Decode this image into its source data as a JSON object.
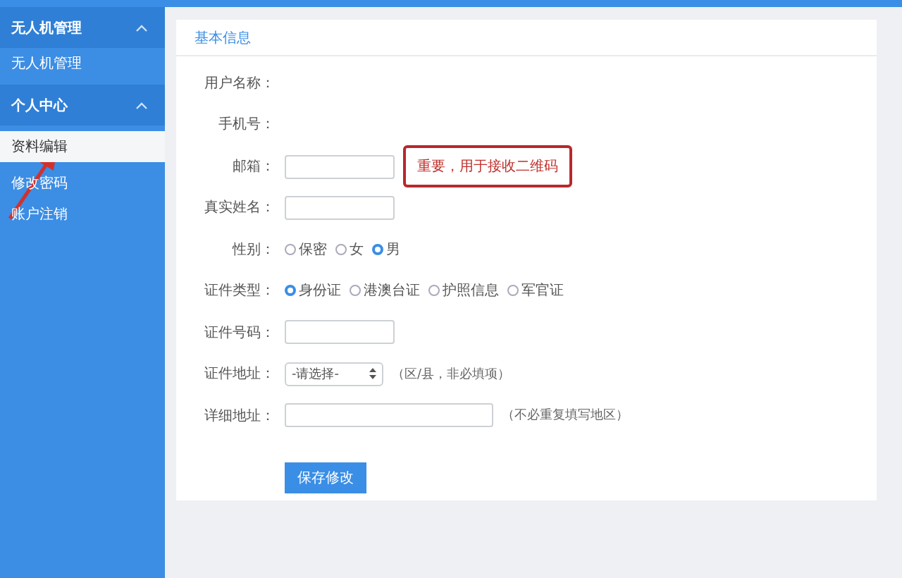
{
  "sidebar": {
    "groups": [
      {
        "title": "无人机管理",
        "expanded": true,
        "items": [
          {
            "label": "无人机管理",
            "selected": false
          }
        ]
      },
      {
        "title": "个人中心",
        "expanded": true,
        "items": [
          {
            "label": "资料编辑",
            "selected": true
          },
          {
            "label": "修改密码",
            "selected": false
          },
          {
            "label": "账户注销",
            "selected": false
          }
        ]
      }
    ]
  },
  "form": {
    "title": "基本信息",
    "fields": [
      {
        "kind": "static",
        "label": "用户名称："
      },
      {
        "kind": "static",
        "label": "手机号："
      },
      {
        "kind": "text",
        "label": "邮箱：",
        "hint": "重要，用于接收二维码"
      },
      {
        "kind": "text",
        "label": "真实姓名："
      },
      {
        "kind": "radio",
        "label": "性别：",
        "options": [
          {
            "label": "保密",
            "selected": false
          },
          {
            "label": "女",
            "selected": false
          },
          {
            "label": "男",
            "selected": true
          }
        ]
      },
      {
        "kind": "radio",
        "label": "证件类型：",
        "options": [
          {
            "label": "身份证",
            "selected": true
          },
          {
            "label": "港澳台证",
            "selected": false
          },
          {
            "label": "护照信息",
            "selected": false
          },
          {
            "label": "军官证",
            "selected": false
          }
        ]
      },
      {
        "kind": "text",
        "label": "证件号码："
      },
      {
        "kind": "select",
        "label": "证件地址：",
        "value": "-请选择-",
        "note": "（区/县，非必填项）"
      },
      {
        "kind": "wide",
        "label": "详细地址：",
        "note": "（不必重复填写地区）"
      }
    ],
    "submit_button": "保存修改"
  }
}
